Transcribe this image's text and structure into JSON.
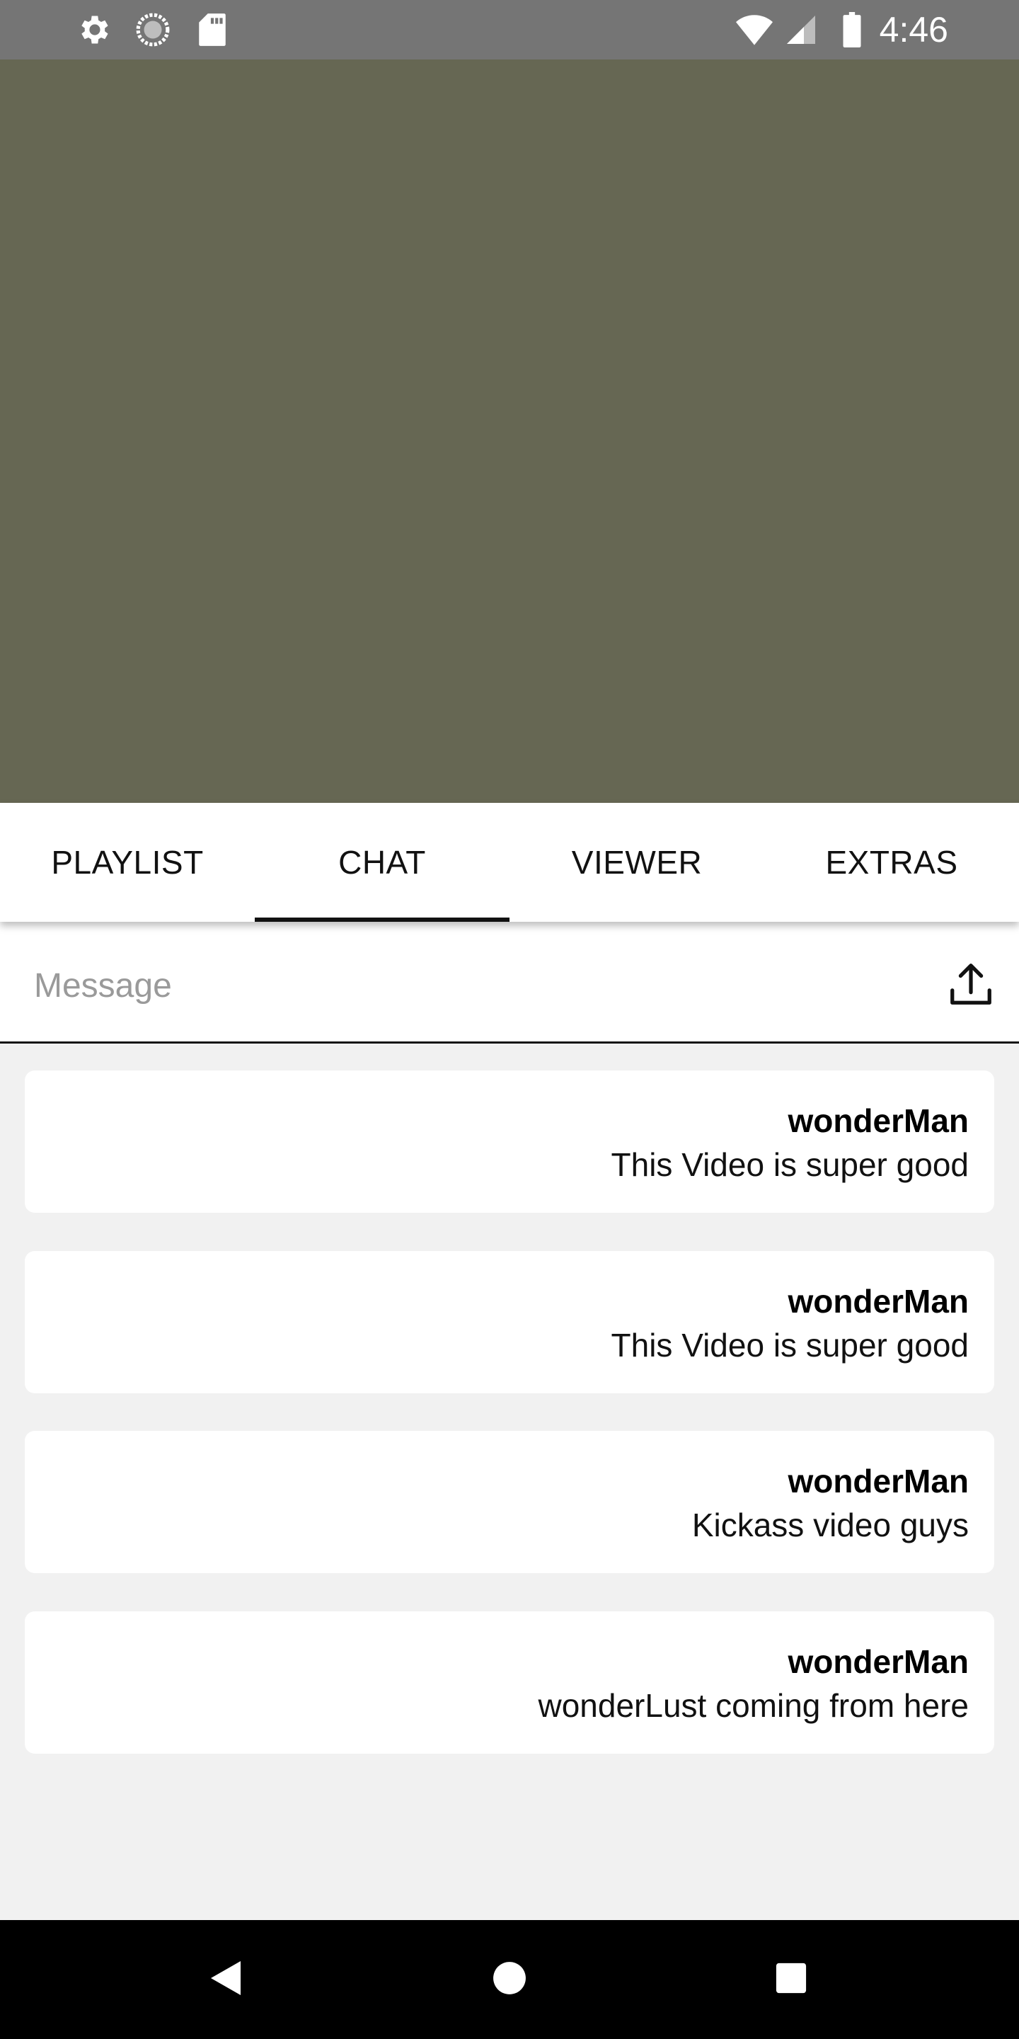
{
  "status_bar": {
    "time": "4:46",
    "icons": [
      "gear-icon",
      "sync-icon",
      "sd-card-icon",
      "wifi-icon",
      "signal-icon",
      "battery-icon"
    ]
  },
  "video": {
    "background_color": "#666753"
  },
  "tabs": [
    {
      "label": "PLAYLIST",
      "active": false
    },
    {
      "label": "CHAT",
      "active": true
    },
    {
      "label": "VIEWER",
      "active": false
    },
    {
      "label": "EXTRAS",
      "active": false
    }
  ],
  "message_bar": {
    "placeholder": "Message",
    "value": "",
    "upload_icon": "upload-icon"
  },
  "chat": {
    "messages": [
      {
        "user": "wonderMan",
        "text": "This Video is super good"
      },
      {
        "user": "wonderMan",
        "text": "This Video is super good"
      },
      {
        "user": "wonderMan",
        "text": "Kickass video guys"
      },
      {
        "user": "wonderMan",
        "text": "wonderLust coming from here"
      }
    ]
  },
  "nav_bar": {
    "buttons": [
      "back-icon",
      "home-icon",
      "recents-icon"
    ]
  }
}
